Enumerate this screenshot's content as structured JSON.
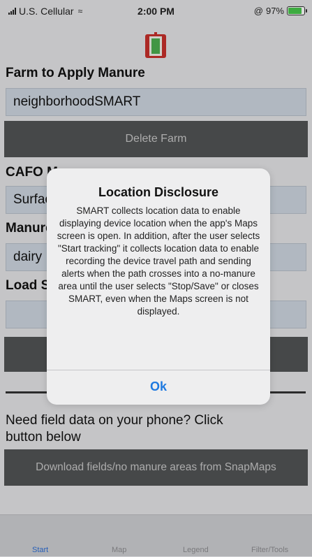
{
  "status": {
    "carrier": "U.S. Cellular",
    "time": "2:00 PM",
    "battery": "97%",
    "battery_level": 0.97
  },
  "farm": {
    "label": "Farm to Apply Manure",
    "value": "neighborhoodSMART",
    "delete_label": "Delete Farm"
  },
  "cafo": {
    "label": "CAFO M",
    "value": "Surfac"
  },
  "manure": {
    "label": "Manure",
    "value": "dairy"
  },
  "load": {
    "label": "Load S"
  },
  "question": "Need field data on your phone? Click button below",
  "download_label": "Download fields/no manure areas from SnapMaps",
  "tabs": [
    {
      "label": "Start",
      "active": true
    },
    {
      "label": "Map"
    },
    {
      "label": "Legend"
    },
    {
      "label": "Filter/Tools"
    }
  ],
  "dialog": {
    "title": "Location Disclosure",
    "message": "SMART collects location data to enable displaying device location when the app's Maps screen is open. In addition, after the user selects \"Start tracking\" it collects location data to enable recording the device travel path and sending alerts when the path crosses into a no-manure area until the user selects \"Stop/Save\" or closes SMART, even when the Maps screen is not displayed.",
    "ok_label": "Ok"
  },
  "colors": {
    "accent": "#1f7ae0",
    "field_bg": "#cfd7e1",
    "dark_button": "#525456"
  }
}
